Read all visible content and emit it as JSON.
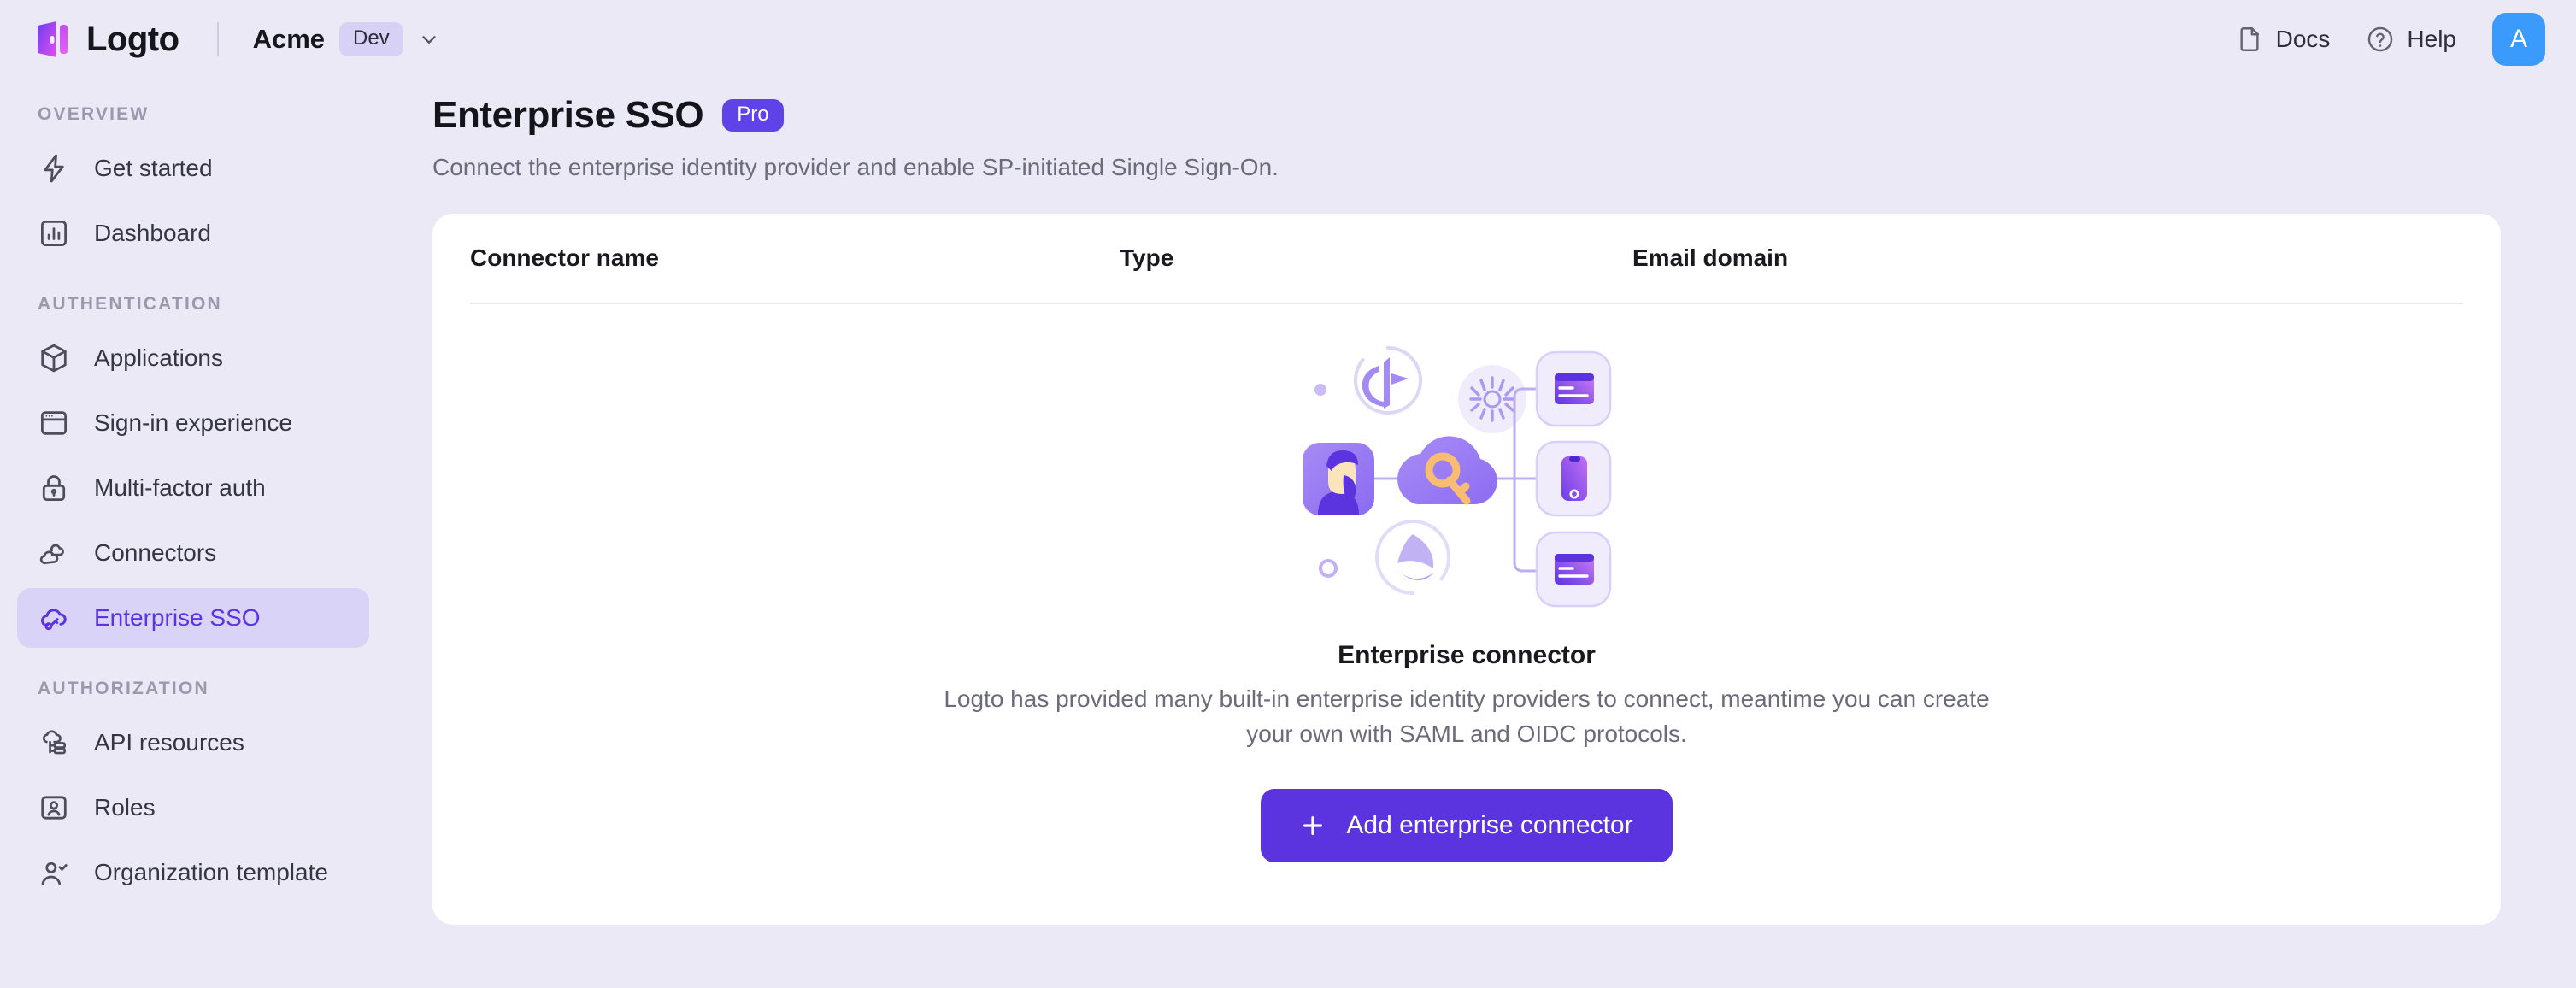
{
  "topbar": {
    "brand_name": "Logto",
    "brand_logo_icon": "logto-logo-icon",
    "tenant_name": "Acme",
    "tenant_badge": "Dev",
    "tenant_chevron_icon": "chevron-down-icon",
    "docs_label": "Docs",
    "docs_icon": "document-icon",
    "help_label": "Help",
    "help_icon": "question-circle-icon",
    "avatar_initial": "A",
    "avatar_color": "#3a9bfc"
  },
  "sidebar": {
    "sections": [
      {
        "title": "OVERVIEW",
        "items": [
          {
            "label": "Get started",
            "icon": "lightning-bolt-icon",
            "active": false
          },
          {
            "label": "Dashboard",
            "icon": "bar-chart-icon",
            "active": false
          }
        ]
      },
      {
        "title": "AUTHENTICATION",
        "items": [
          {
            "label": "Applications",
            "icon": "cube-icon",
            "active": false
          },
          {
            "label": "Sign-in experience",
            "icon": "browser-window-icon",
            "active": false
          },
          {
            "label": "Multi-factor auth",
            "icon": "lock-icon",
            "active": false
          },
          {
            "label": "Connectors",
            "icon": "clouds-icon",
            "active": false
          },
          {
            "label": "Enterprise SSO",
            "icon": "cloud-key-icon",
            "active": true
          }
        ]
      },
      {
        "title": "AUTHORIZATION",
        "items": [
          {
            "label": "API resources",
            "icon": "cloud-database-icon",
            "active": false
          },
          {
            "label": "Roles",
            "icon": "user-card-icon",
            "active": false
          },
          {
            "label": "Organization template",
            "icon": "user-check-icon",
            "active": false
          }
        ]
      }
    ],
    "active_color": "#5b34e0",
    "active_background": "#d9d3f7"
  },
  "page": {
    "title": "Enterprise SSO",
    "badge": "Pro",
    "badge_color": "#6043e8",
    "subtitle": "Connect the enterprise identity provider and enable SP-initiated Single Sign-On."
  },
  "table": {
    "columns": [
      "Connector name",
      "Type",
      "Email domain"
    ],
    "rows": []
  },
  "empty_state": {
    "illustration_icon": "enterprise-sso-illustration",
    "title": "Enterprise connector",
    "description": "Logto has provided many built-in enterprise identity providers to connect, meantime you can create your own with SAML and OIDC protocols.",
    "button_label": "Add enterprise connector",
    "button_icon": "plus-icon",
    "button_color": "#5b34e0"
  },
  "theme": {
    "page_background": "#ebe9f5",
    "card_background": "#ffffff",
    "text_primary": "#19191f",
    "text_secondary": "#6b6b7b"
  }
}
